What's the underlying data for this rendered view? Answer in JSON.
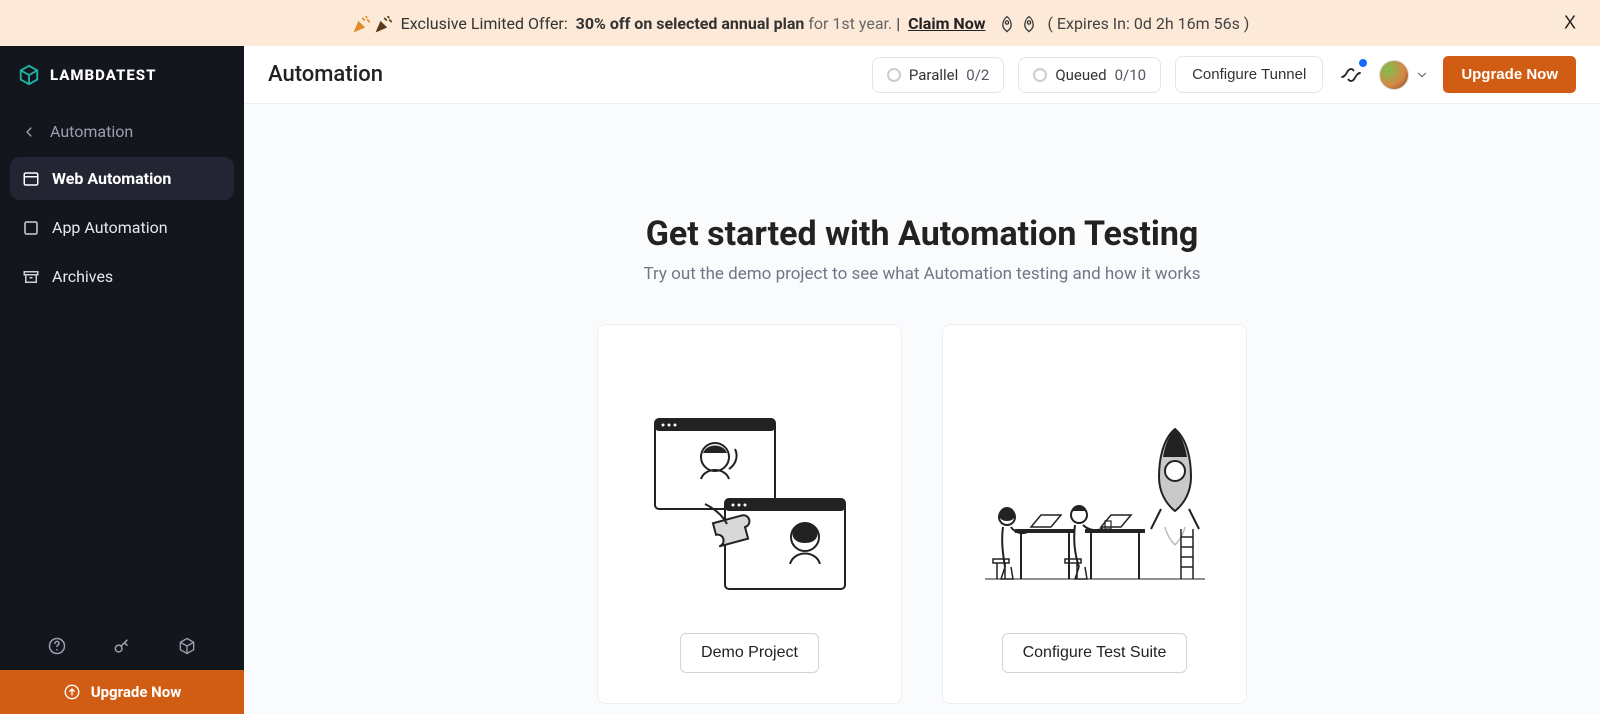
{
  "promo": {
    "prefix": "Exclusive Limited Offer:",
    "discount": "30% off on selected annual plan",
    "suffix": "for 1st year.",
    "separator": "|",
    "claim": "Claim Now",
    "expires": "( Expires In: 0d 2h 16m 56s )",
    "close": "X"
  },
  "brand": {
    "name": "LAMBDATEST"
  },
  "sidebar": {
    "parent": "Automation",
    "items": [
      {
        "label": "Web Automation",
        "active": true
      },
      {
        "label": "App Automation",
        "active": false
      },
      {
        "label": "Archives",
        "active": false
      }
    ],
    "upgrade": "Upgrade Now"
  },
  "topbar": {
    "title": "Automation",
    "parallel_label": "Parallel",
    "parallel_value": "0/2",
    "queued_label": "Queued",
    "queued_value": "0/10",
    "tunnel": "Configure Tunnel",
    "upgrade": "Upgrade Now"
  },
  "hero": {
    "heading": "Get started with Automation Testing",
    "sub": "Try out the demo project to see what Automation testing and how it works"
  },
  "cards": {
    "demo": "Demo Project",
    "configure": "Configure Test Suite"
  }
}
